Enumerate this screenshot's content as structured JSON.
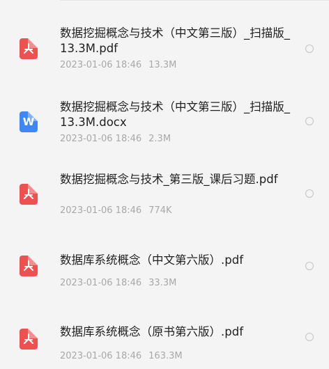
{
  "files": [
    {
      "name": "数据挖掘概念与技术（中文第三版）_扫描版_13.3M.pdf",
      "type": "pdf",
      "icon": "pdf-icon",
      "date": "2023-01-06 18:46",
      "size": "13.3M"
    },
    {
      "name": "数据挖掘概念与技术（中文第三版）_扫描版_13.3M.docx",
      "type": "docx",
      "icon": "word-icon",
      "icon_letter": "W",
      "date": "2023-01-06 18:46",
      "size": "2.3M"
    },
    {
      "name": "数据挖掘概念与技术_第三版_课后习题.pdf",
      "type": "pdf",
      "icon": "pdf-icon",
      "date": "2023-01-06 18:46",
      "size": "774K"
    },
    {
      "name": "数据库系统概念（中文第六版）.pdf",
      "type": "pdf",
      "icon": "pdf-icon",
      "date": "2023-01-06 18:46",
      "size": "33.3M"
    },
    {
      "name": "数据库系统概念（原书第六版）.pdf",
      "type": "pdf",
      "icon": "pdf-icon",
      "date": "2023-01-06 18:46",
      "size": "163.3M"
    }
  ],
  "colors": {
    "pdf": "#ef5050",
    "docx": "#3f86f7",
    "meta_text": "#a8a8a8",
    "name_text": "#1f1f1f",
    "background": "#f4f4f4"
  }
}
